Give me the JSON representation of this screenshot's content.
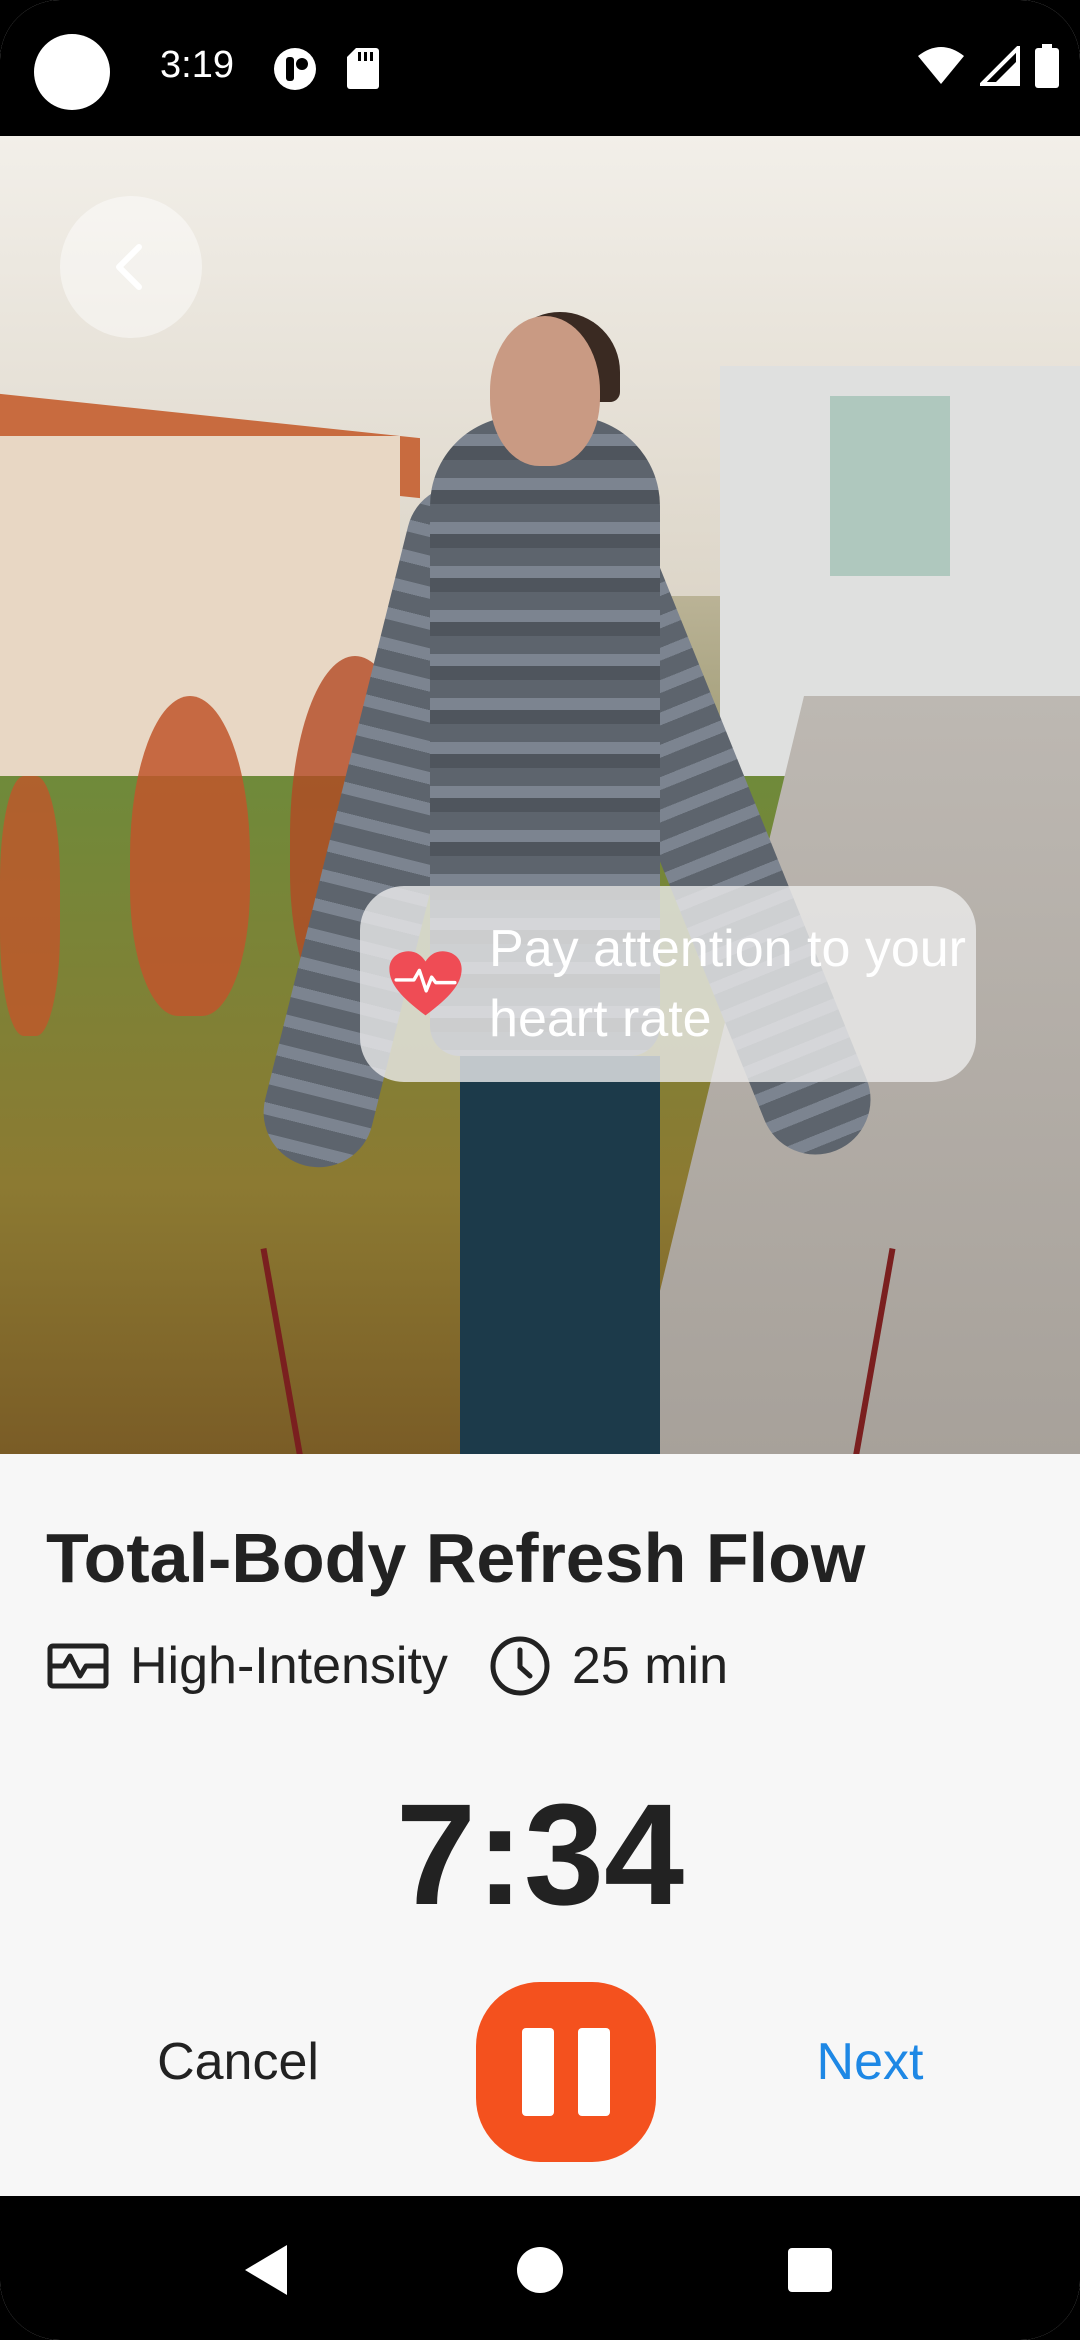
{
  "status_bar": {
    "time": "3:19"
  },
  "hero": {
    "banner_text": "Pay attention to your heart rate"
  },
  "workout": {
    "title": "Total-Body Refresh Flow",
    "intensity": "High-Intensity",
    "duration": "25 min",
    "timer": "7:34"
  },
  "controls": {
    "cancel_label": "Cancel",
    "next_label": "Next"
  },
  "colors": {
    "accent": "#f4511e",
    "link": "#1e88e5",
    "heart": "#ef4c55"
  },
  "icons": {
    "back": "chevron-left-icon",
    "heart": "heart-rate-icon",
    "intensity": "activity-monitor-icon",
    "duration": "clock-icon",
    "pause": "pause-icon"
  }
}
